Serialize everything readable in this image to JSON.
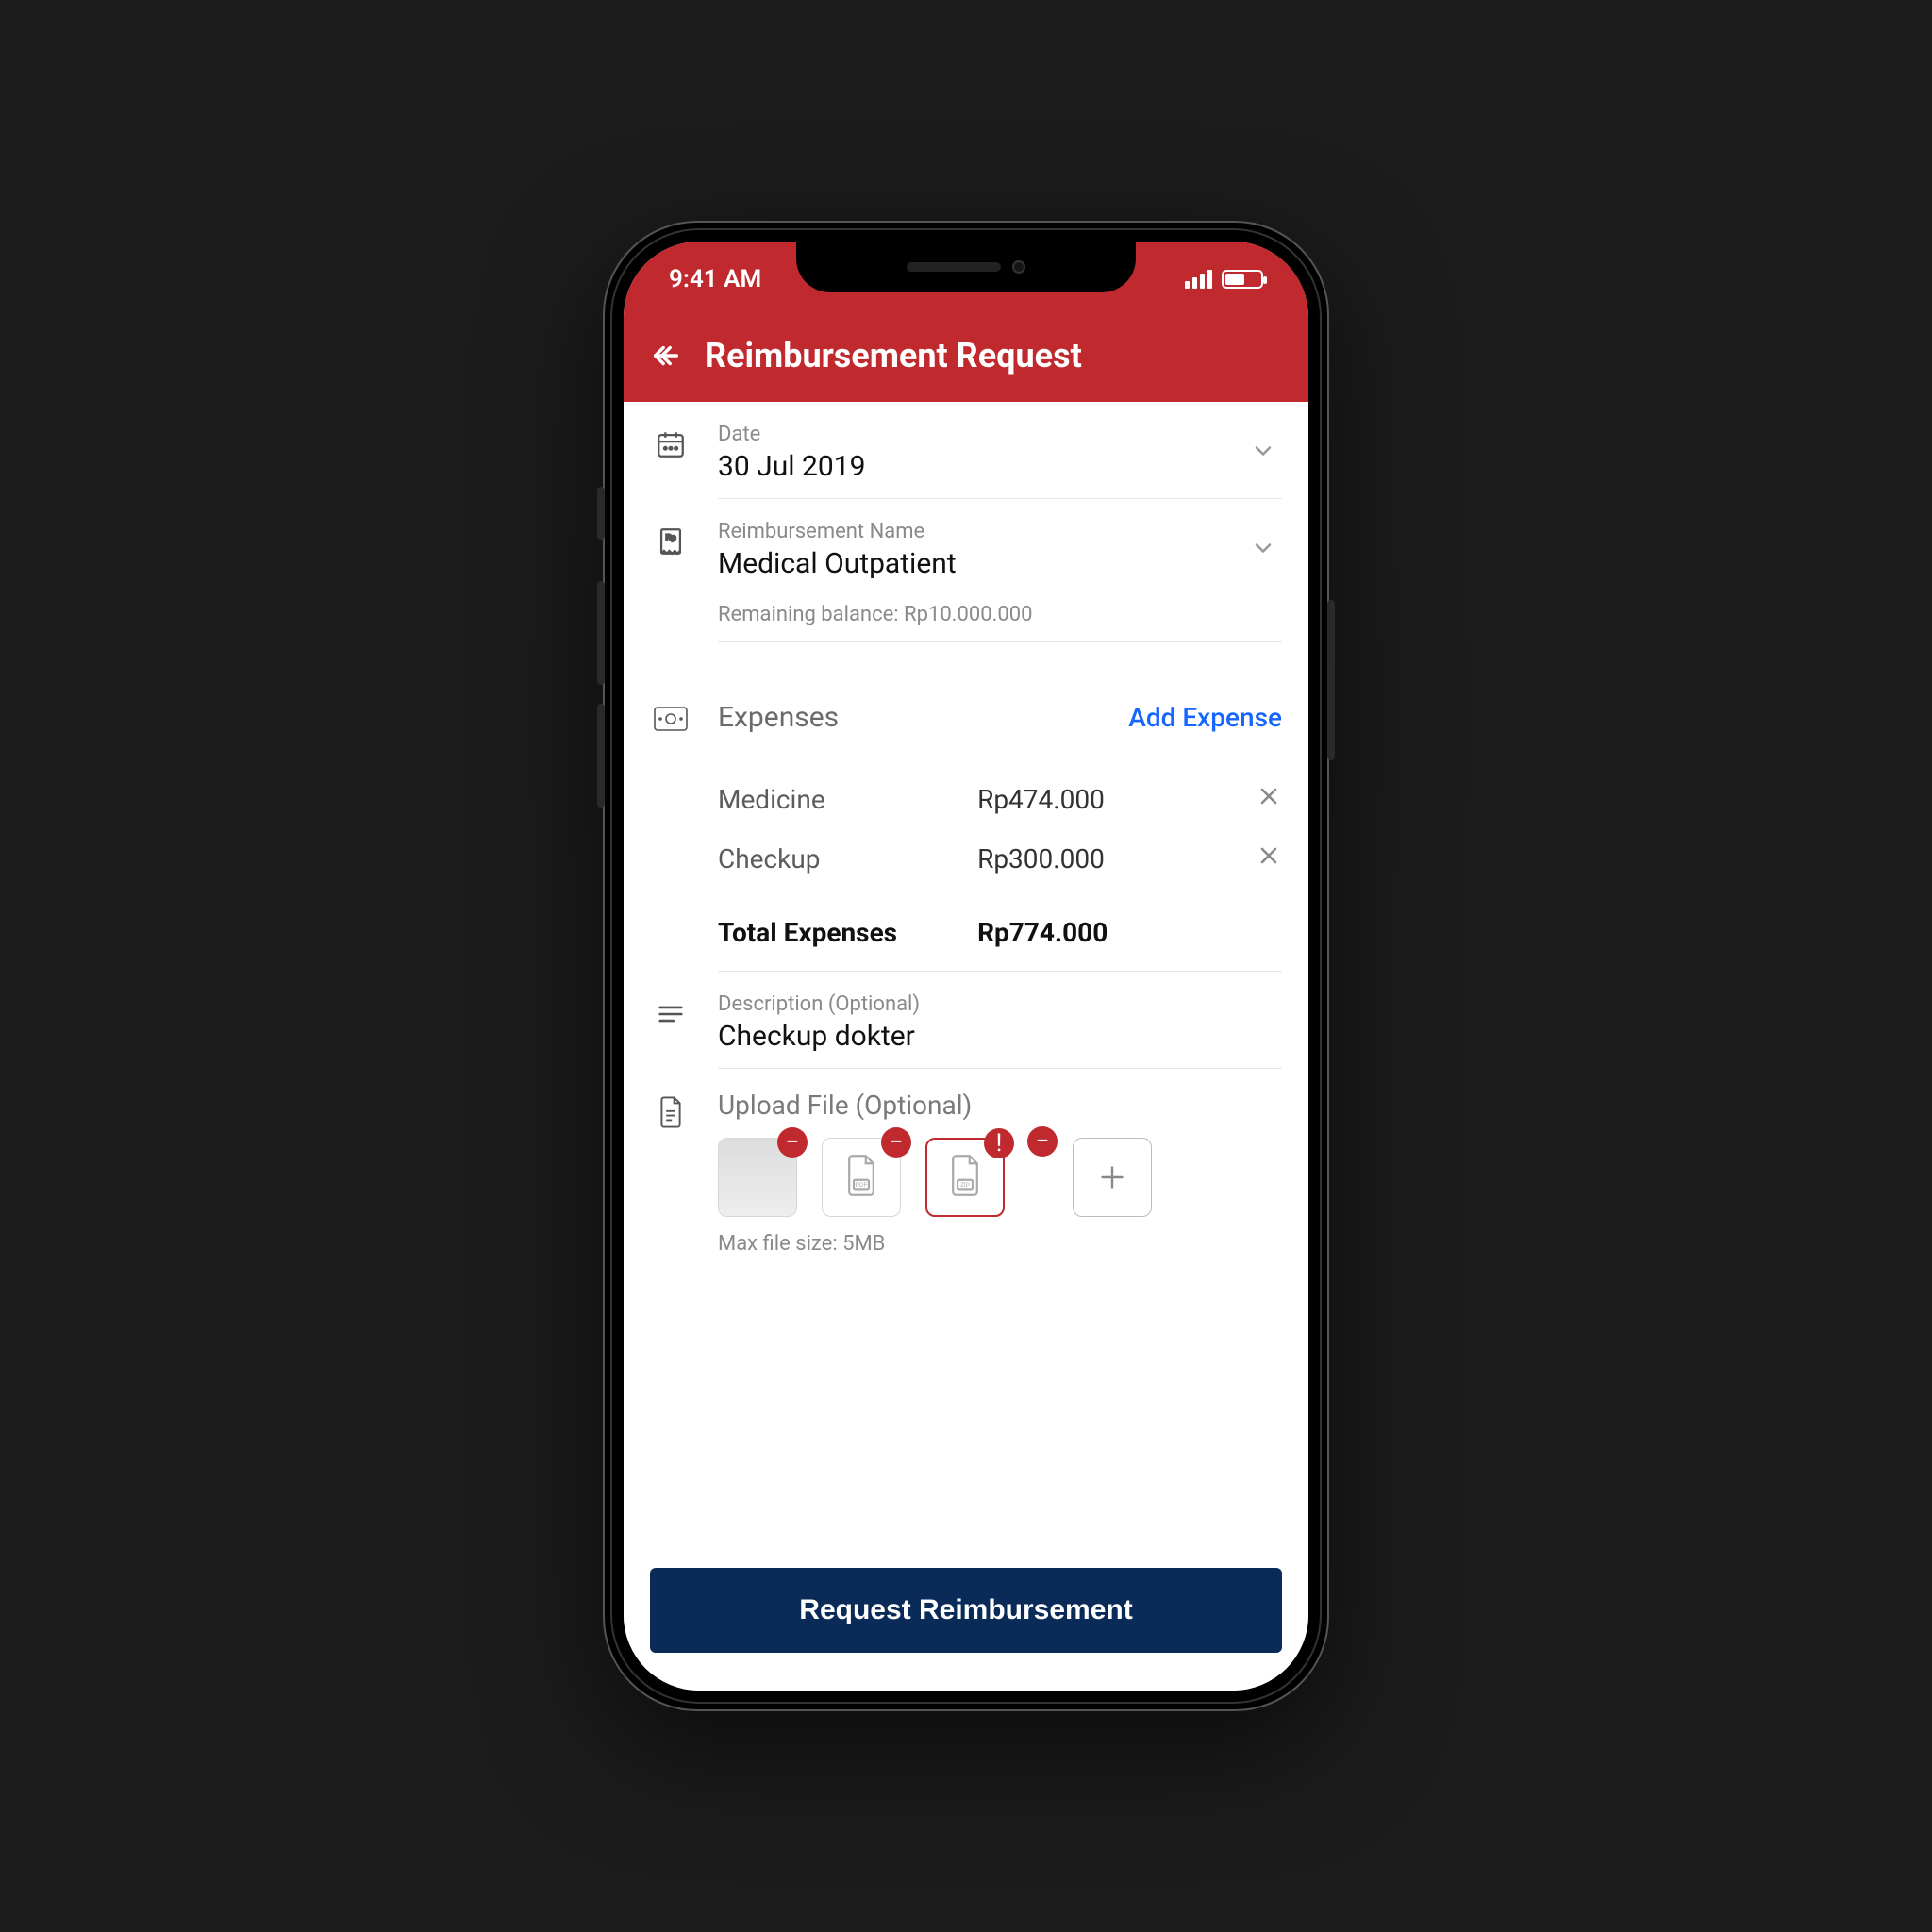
{
  "status": {
    "time": "9:41 AM"
  },
  "header": {
    "title": "Reimbursement Request"
  },
  "date_field": {
    "label": "Date",
    "value": "30 Jul 2019"
  },
  "name_field": {
    "label": "Reimbursement Name",
    "value": "Medical Outpatient"
  },
  "balance_hint": "Remaining balance: Rp10.000.000",
  "expenses": {
    "title": "Expenses",
    "add_label": "Add Expense",
    "items": [
      {
        "name": "Medicine",
        "amount": "Rp474.000"
      },
      {
        "name": "Checkup",
        "amount": "Rp300.000"
      }
    ],
    "total_label": "Total Expenses",
    "total_value": "Rp774.000"
  },
  "description": {
    "label": "Description (Optional)",
    "value": "Checkup dokter"
  },
  "upload": {
    "label": "Upload File (Optional)",
    "hint": "Max file size: 5MB",
    "tiles": [
      {
        "kind": "image",
        "removable": true,
        "error": false
      },
      {
        "kind": "pdf",
        "removable": true,
        "error": false
      },
      {
        "kind": "zip",
        "removable": true,
        "error": true
      },
      {
        "kind": "image",
        "removable": true,
        "error": false
      },
      {
        "kind": "add",
        "removable": false,
        "error": false
      }
    ]
  },
  "submit_label": "Request Reimbursement",
  "colors": {
    "brand_red": "#c02a2f",
    "primary_blue": "#0a2a57",
    "link_blue": "#1766ff"
  }
}
